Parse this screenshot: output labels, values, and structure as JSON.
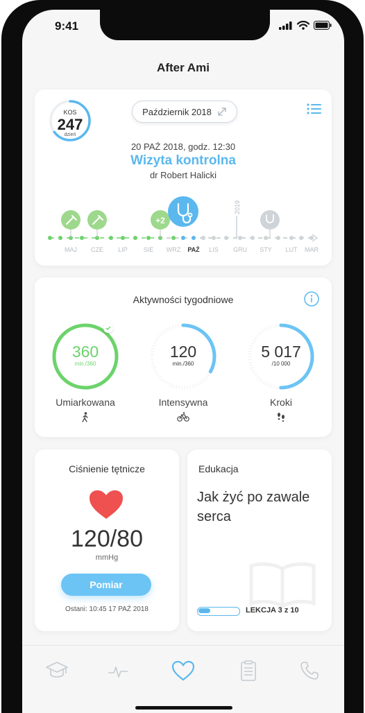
{
  "status": {
    "time": "9:41"
  },
  "app": {
    "title": "After Ami"
  },
  "visit_card": {
    "kos": {
      "label": "KOS",
      "value": "247",
      "unit": "dzień",
      "progress": 0.65
    },
    "month_pill": "Październik 2018",
    "date": "20 PAŹ 2018, godz. 12:30",
    "title": "Wizyta kontrolna",
    "doctor": "dr Robert Halicki",
    "timeline": {
      "months": [
        "MAJ",
        "CZE",
        "LIP",
        "SIE",
        "WRZ",
        "PAŹ",
        "LIS",
        "GRU",
        "STY",
        "LUT",
        "MAR"
      ],
      "current": "PAŹ",
      "year_marker": "2019",
      "badge": "+2"
    }
  },
  "activities": {
    "title": "Aktywności tygodniowe",
    "items": [
      {
        "value": "360",
        "sub": "min./360",
        "label": "Umiarkowana",
        "icon": "walk-icon",
        "progress": 1.0,
        "color": "#6cd36b"
      },
      {
        "value": "120",
        "sub": "min./360",
        "label": "Intensywna",
        "icon": "bike-icon",
        "progress": 0.33,
        "color": "#6cc4f4"
      },
      {
        "value": "5 017",
        "sub": "/10 000",
        "label": "Kroki",
        "icon": "footsteps-icon",
        "progress": 0.5,
        "color": "#6cc4f4"
      }
    ]
  },
  "blood_pressure": {
    "title": "Ciśnienie tętnicze",
    "value": "120/80",
    "unit": "mmHg",
    "button": "Pomiar",
    "last": "Ostani: 10:45  17 PAŹ 2018",
    "heart_color": "#ef5050"
  },
  "education": {
    "title": "Edukacja",
    "headline": "Jak żyć po zawale serca",
    "lesson": "LEKCJA 3 z 10",
    "progress": 0.3
  },
  "tabs": [
    "graduation-cap-icon",
    "pulse-icon",
    "heart-icon",
    "clipboard-icon",
    "phone-icon"
  ],
  "active_tab": "heart-icon",
  "colors": {
    "accent": "#5ab8ee",
    "green": "#6cd36b"
  }
}
